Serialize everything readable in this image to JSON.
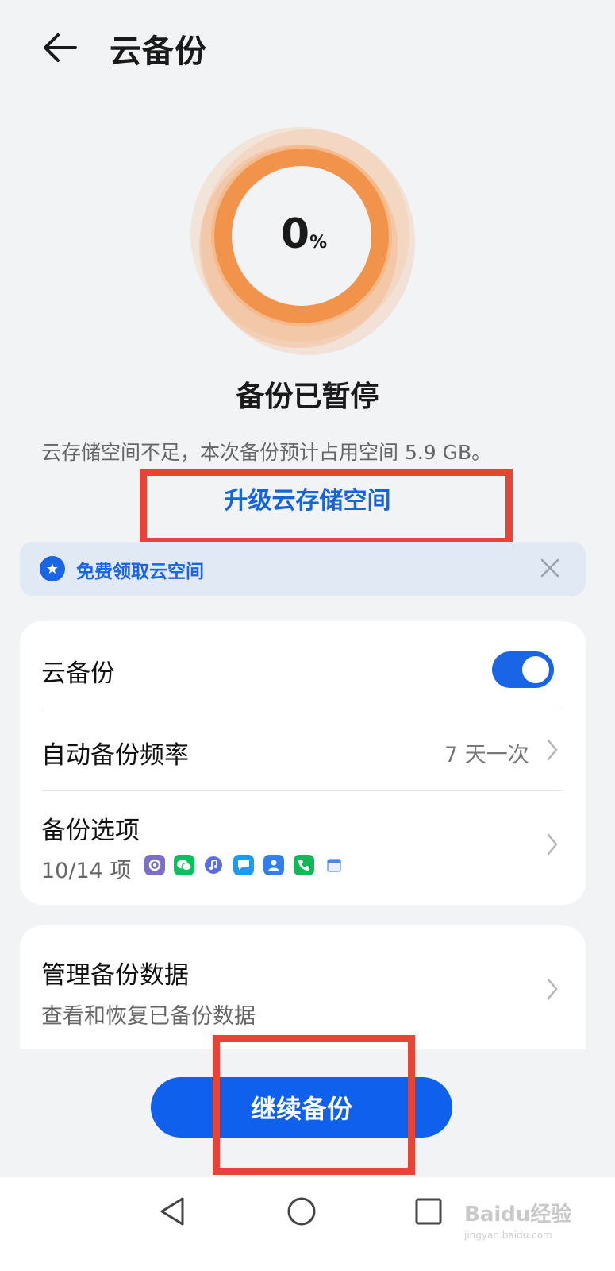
{
  "header": {
    "title": "云备份",
    "back_icon": "arrow-left-icon"
  },
  "progress": {
    "value_percent": 0,
    "number": "0",
    "unit": "%"
  },
  "status": {
    "title": "备份已暂停",
    "description": "云存储空间不足，本次备份预计占用空间 5.9 GB。",
    "upgrade_link": "升级云存储空间"
  },
  "promo": {
    "icon": "star-badge-icon",
    "text": "免费领取云空间",
    "close_icon": "close-icon"
  },
  "settings": {
    "cloud_backup": {
      "label": "云备份",
      "enabled": true
    },
    "frequency": {
      "label": "自动备份频率",
      "value": "7 天一次"
    },
    "options": {
      "label": "备份选项",
      "count": "10/14 项",
      "icons": [
        "settings-app-icon",
        "wechat-icon",
        "music-icon",
        "messages-icon",
        "contacts-icon",
        "phone-icon",
        "calendar-icon"
      ]
    },
    "manage": {
      "label": "管理备份数据",
      "sub": "查看和恢复已备份数据"
    }
  },
  "action": {
    "continue_label": "继续备份"
  },
  "navbar": {
    "back": "nav-back-icon",
    "home": "nav-home-icon",
    "recent": "nav-recent-icon"
  },
  "watermark": {
    "text": "Baidu经验",
    "sub": "jingyan.baidu.com"
  },
  "colors": {
    "accent": "#1a64e6",
    "ring": "#f08a3c",
    "highlight": "#e44536"
  }
}
